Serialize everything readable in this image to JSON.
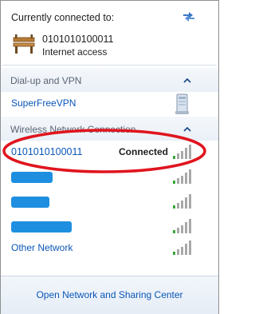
{
  "header": {
    "title": "Currently connected to:",
    "connection_name": "0101010100011",
    "connection_status": "Internet access"
  },
  "dialup_section": {
    "title": "Dial-up and VPN",
    "items": [
      {
        "label": "SuperFreeVPN",
        "icon": "vpn-icon"
      }
    ]
  },
  "wireless_section": {
    "title": "Wireless Network Connection",
    "items": [
      {
        "label": "0101010100011",
        "status": "Connected",
        "signal_bars": 5
      },
      {
        "label": "",
        "status": "",
        "signal_bars": 5
      },
      {
        "label": "",
        "status": "",
        "signal_bars": 5
      },
      {
        "label": "",
        "status": "",
        "signal_bars": 5
      },
      {
        "label": "Other Network",
        "status": "",
        "signal_bars": 5
      }
    ]
  },
  "footer": {
    "link": "Open Network and Sharing Center"
  },
  "colors": {
    "link": "#0a56b8",
    "annotation": "#e0141e",
    "signal_active": "#3aa63a",
    "signal_inactive": "#a8a8a8"
  }
}
